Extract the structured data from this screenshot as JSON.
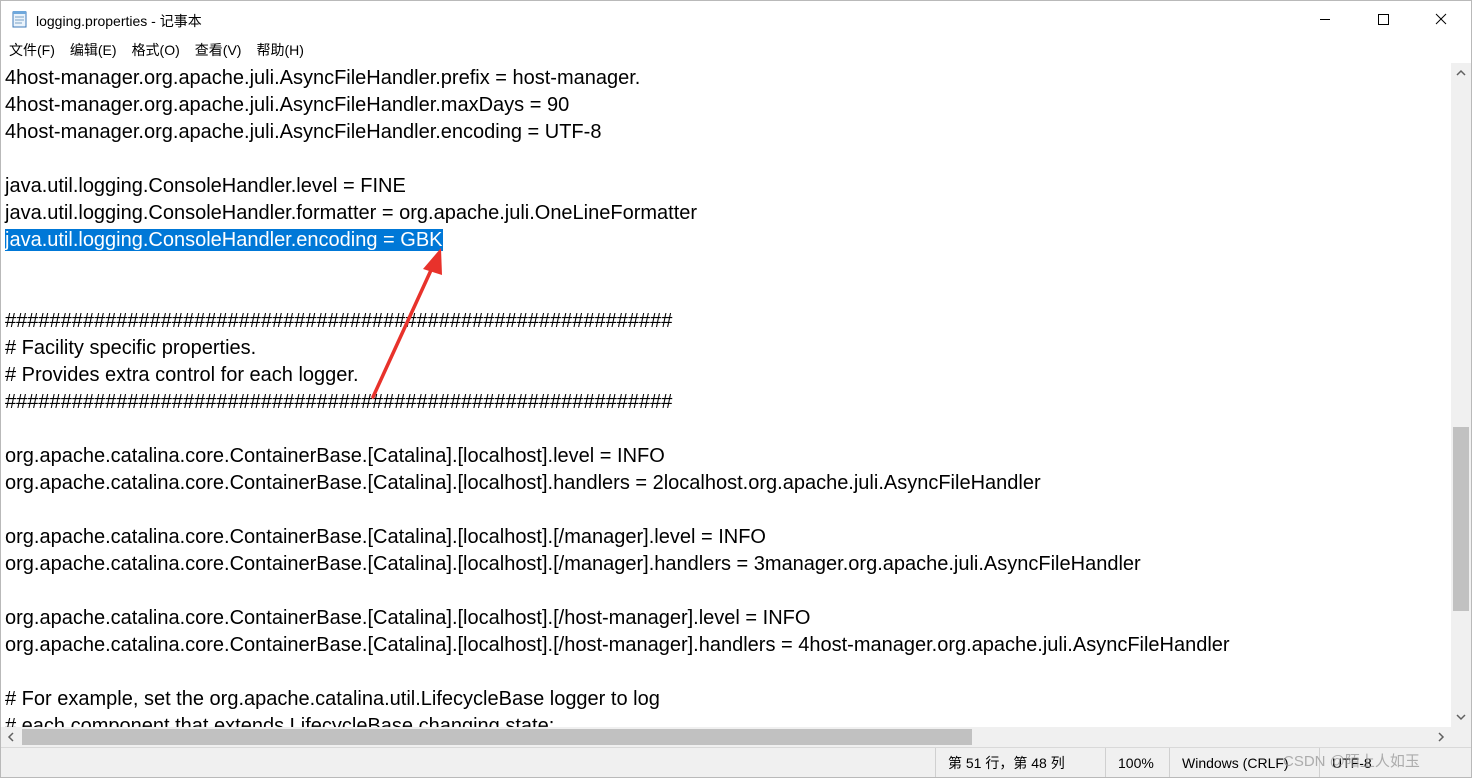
{
  "window": {
    "title": "logging.properties - 记事本",
    "controls": {
      "minimize": "minimize-icon",
      "maximize": "maximize-icon",
      "close": "close-icon"
    }
  },
  "menu": {
    "file": "文件(F)",
    "edit": "编辑(E)",
    "format": "格式(O)",
    "view": "查看(V)",
    "help": "帮助(H)"
  },
  "editor": {
    "lines": [
      "4host-manager.org.apache.juli.AsyncFileHandler.prefix = host-manager.",
      "4host-manager.org.apache.juli.AsyncFileHandler.maxDays = 90",
      "4host-manager.org.apache.juli.AsyncFileHandler.encoding = UTF-8",
      "",
      "java.util.logging.ConsoleHandler.level = FINE",
      "java.util.logging.ConsoleHandler.formatter = org.apache.juli.OneLineFormatter",
      "java.util.logging.ConsoleHandler.encoding = GBK",
      "",
      "",
      "############################################################",
      "# Facility specific properties.",
      "# Provides extra control for each logger.",
      "############################################################",
      "",
      "org.apache.catalina.core.ContainerBase.[Catalina].[localhost].level = INFO",
      "org.apache.catalina.core.ContainerBase.[Catalina].[localhost].handlers = 2localhost.org.apache.juli.AsyncFileHandler",
      "",
      "org.apache.catalina.core.ContainerBase.[Catalina].[localhost].[/manager].level = INFO",
      "org.apache.catalina.core.ContainerBase.[Catalina].[localhost].[/manager].handlers = 3manager.org.apache.juli.AsyncFileHandler",
      "",
      "org.apache.catalina.core.ContainerBase.[Catalina].[localhost].[/host-manager].level = INFO",
      "org.apache.catalina.core.ContainerBase.[Catalina].[localhost].[/host-manager].handlers = 4host-manager.org.apache.juli.AsyncFileHandler",
      "",
      "# For example, set the org.apache.catalina.util.LifecycleBase logger to log",
      "# each component that extends LifecycleBase changing state:"
    ],
    "selected_line_index": 6
  },
  "annotation": {
    "arrow_color": "#e8322b"
  },
  "colors": {
    "selection": "#0078d7"
  },
  "status": {
    "position": "第 51 行，第 48 列",
    "zoom": "100%",
    "line_ending": "Windows (CRLF)",
    "encoding": "UTF-8"
  },
  "watermark": "CSDN @陌上人如玉"
}
